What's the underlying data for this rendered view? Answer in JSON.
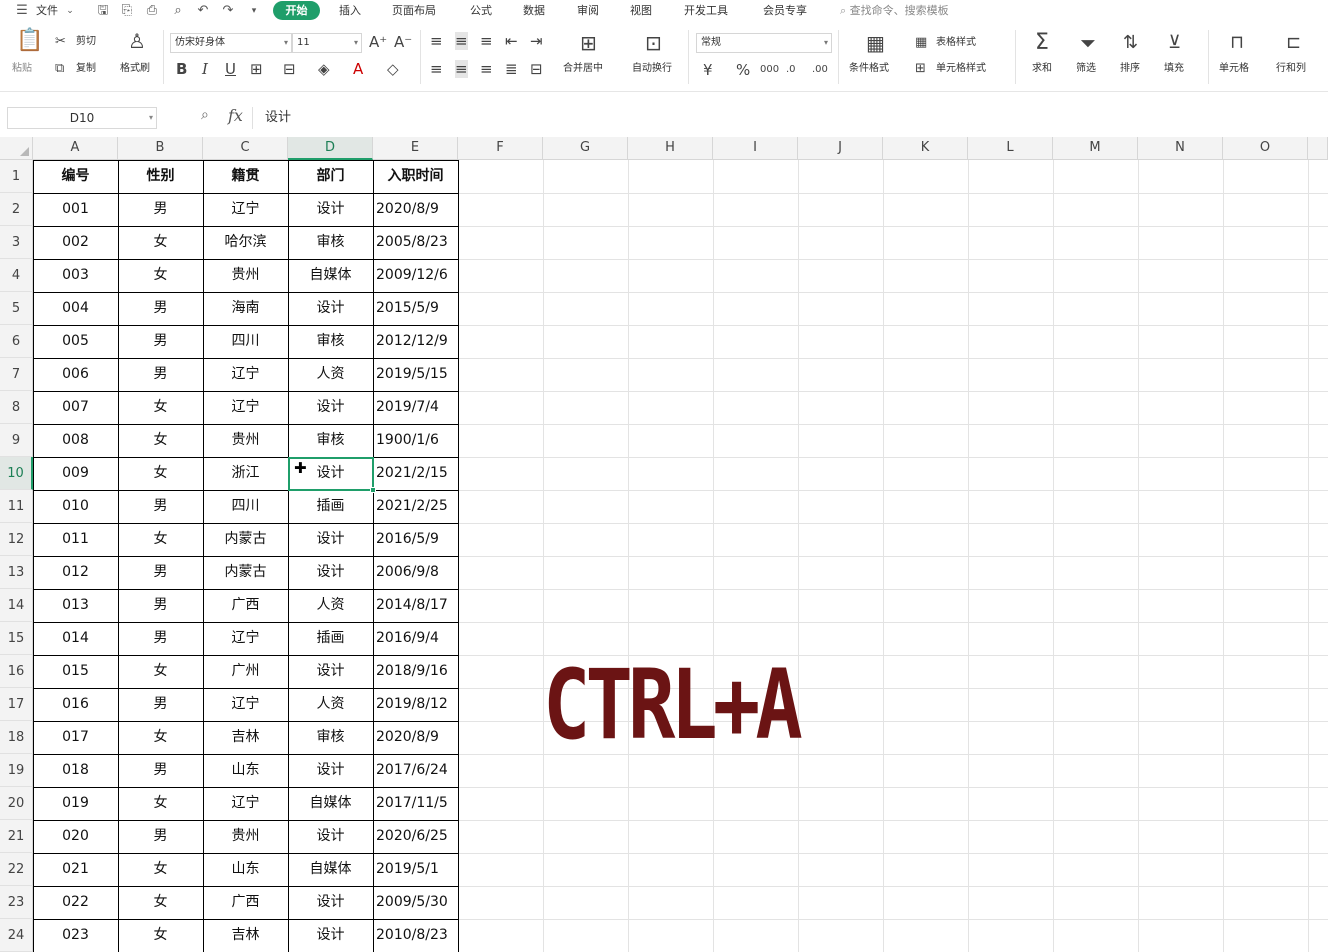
{
  "menu": {
    "file_label": "文件",
    "tabs": [
      "开始",
      "插入",
      "页面布局",
      "公式",
      "数据",
      "审阅",
      "视图",
      "开发工具",
      "会员专享"
    ],
    "search_placeholder": "查找命令、搜索模板"
  },
  "ribbon": {
    "paste": "粘贴",
    "cut": "剪切",
    "copy": "复制",
    "format_painter": "格式刷",
    "font_name": "仿宋好身体",
    "font_size": "11",
    "merge_center": "合并居中",
    "wrap_text": "自动换行",
    "number_format": "常规",
    "conditional_format": "条件格式",
    "table_style": "表格样式",
    "cell_style": "单元格样式",
    "sum": "求和",
    "filter": "筛选",
    "sort": "排序",
    "fill": "填充",
    "cell": "单元格",
    "row_col": "行和列"
  },
  "formula_bar": {
    "name_box": "D10",
    "fx": "fx",
    "content": "设计"
  },
  "sheet": {
    "columns": [
      "A",
      "B",
      "C",
      "D",
      "E",
      "F",
      "G",
      "H",
      "I",
      "J",
      "K",
      "L",
      "M",
      "N",
      "O"
    ],
    "active_column": "D",
    "active_row": 10,
    "header": [
      "编号",
      "性别",
      "籍贯",
      "部门",
      "入职时间"
    ],
    "rows": [
      [
        "001",
        "男",
        "辽宁",
        "设计",
        "2020/8/9"
      ],
      [
        "002",
        "女",
        "哈尔滨",
        "审核",
        "2005/8/23"
      ],
      [
        "003",
        "女",
        "贵州",
        "自媒体",
        "2009/12/6"
      ],
      [
        "004",
        "男",
        "海南",
        "设计",
        "2015/5/9"
      ],
      [
        "005",
        "男",
        "四川",
        "审核",
        "2012/12/9"
      ],
      [
        "006",
        "男",
        "辽宁",
        "人资",
        "2019/5/15"
      ],
      [
        "007",
        "女",
        "辽宁",
        "设计",
        "2019/7/4"
      ],
      [
        "008",
        "女",
        "贵州",
        "审核",
        "1900/1/6"
      ],
      [
        "009",
        "女",
        "浙江",
        "设计",
        "2021/2/15"
      ],
      [
        "010",
        "男",
        "四川",
        "插画",
        "2021/2/25"
      ],
      [
        "011",
        "女",
        "内蒙古",
        "设计",
        "2016/5/9"
      ],
      [
        "012",
        "男",
        "内蒙古",
        "设计",
        "2006/9/8"
      ],
      [
        "013",
        "男",
        "广西",
        "人资",
        "2014/8/17"
      ],
      [
        "014",
        "男",
        "辽宁",
        "插画",
        "2016/9/4"
      ],
      [
        "015",
        "女",
        "广州",
        "设计",
        "2018/9/16"
      ],
      [
        "016",
        "男",
        "辽宁",
        "人资",
        "2019/8/12"
      ],
      [
        "017",
        "女",
        "吉林",
        "审核",
        "2020/8/9"
      ],
      [
        "018",
        "男",
        "山东",
        "设计",
        "2017/6/24"
      ],
      [
        "019",
        "女",
        "辽宁",
        "自媒体",
        "2017/11/5"
      ],
      [
        "020",
        "男",
        "贵州",
        "设计",
        "2020/6/25"
      ],
      [
        "021",
        "女",
        "山东",
        "自媒体",
        "2019/5/1"
      ],
      [
        "022",
        "女",
        "广西",
        "设计",
        "2009/5/30"
      ],
      [
        "023",
        "女",
        "吉林",
        "设计",
        "2010/8/23"
      ]
    ]
  },
  "overlay_text": "CTRL+A",
  "colors": {
    "accent": "#1f9e6a",
    "overlay": "#6b1414"
  }
}
